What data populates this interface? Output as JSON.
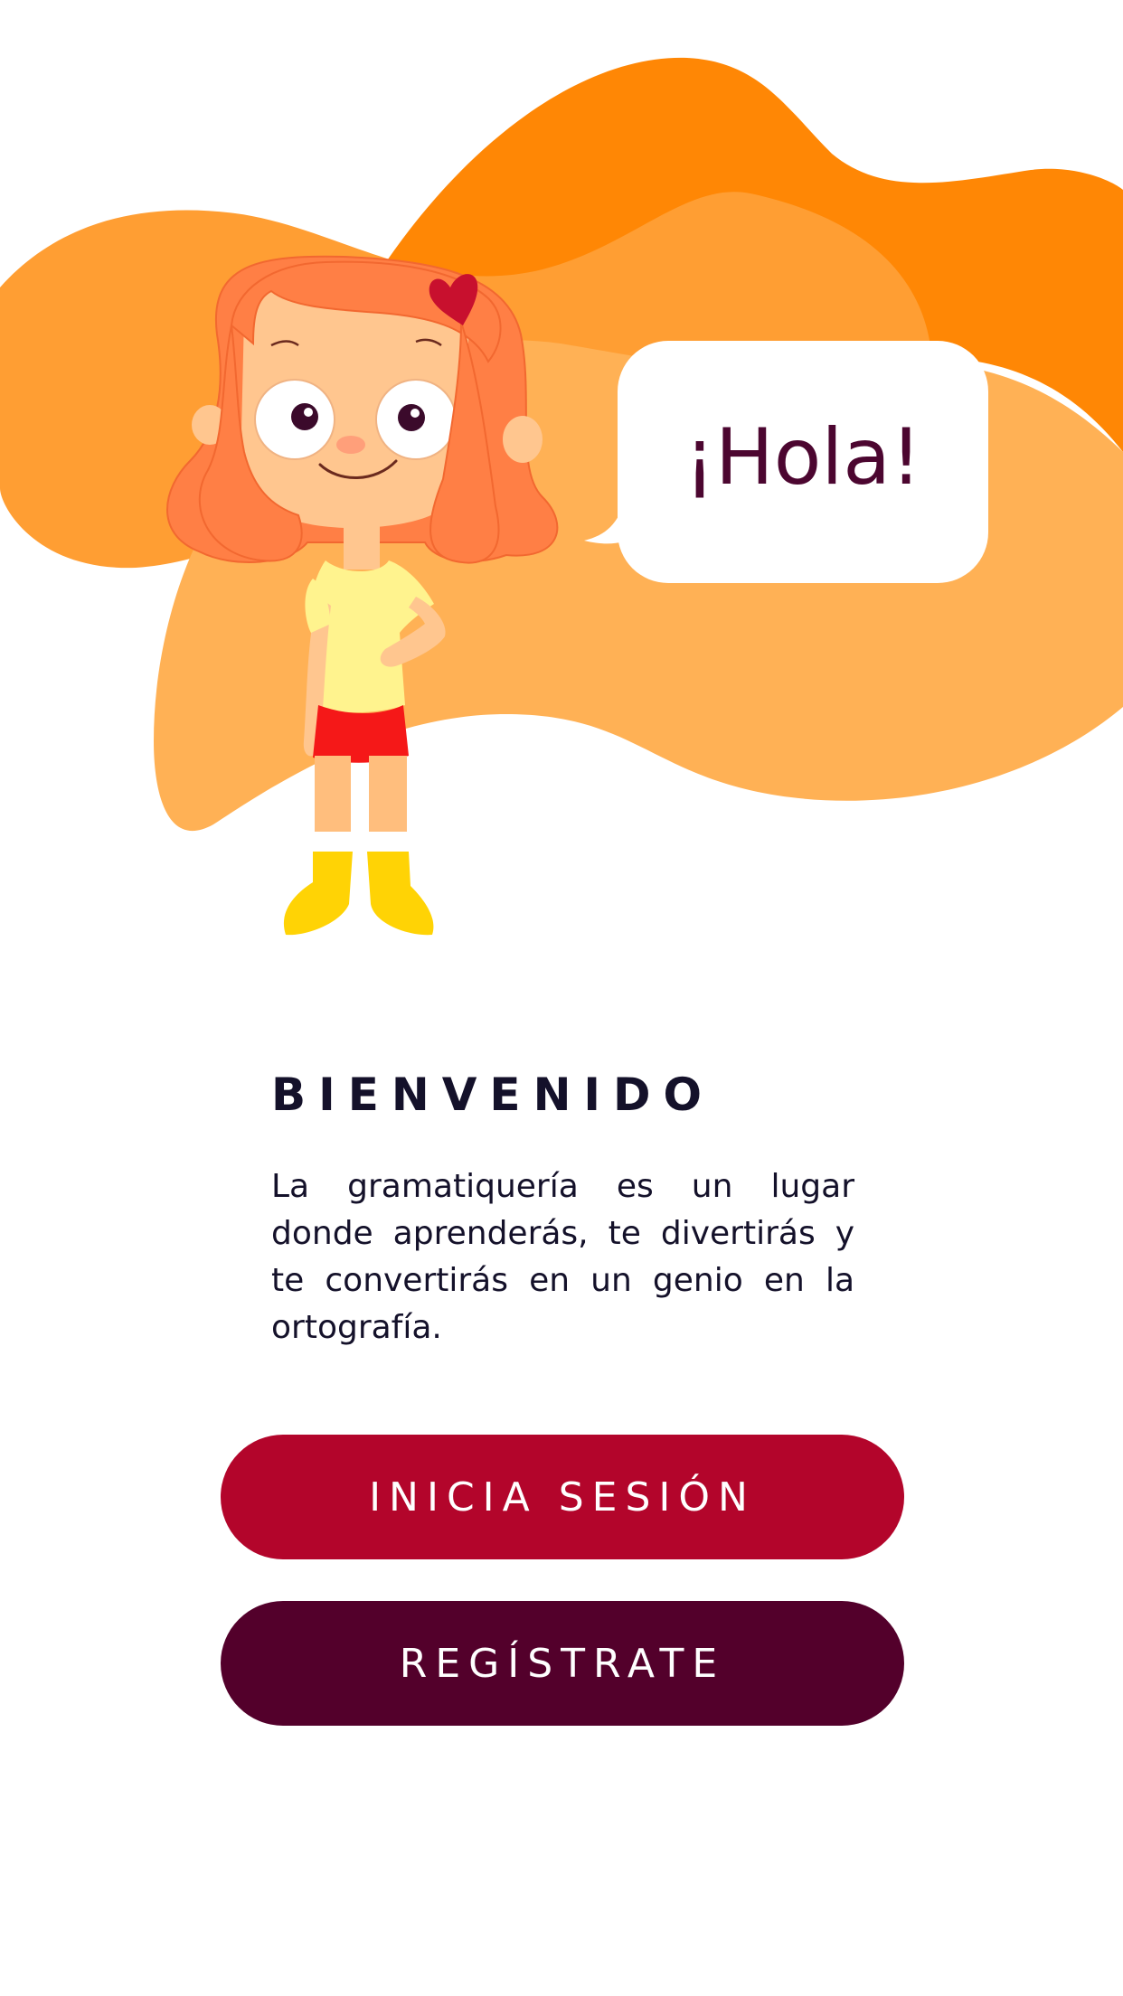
{
  "hero": {
    "greeting": "¡Hola!",
    "character": "girl-mascot-illustration"
  },
  "welcome": {
    "title": "BIENVENIDO",
    "text": "La gramatiquería es un lugar donde aprenderás, te divertirás y te convertirás en un genio en la ortografía."
  },
  "actions": {
    "login_label": "INICIA SESIÓN",
    "register_label": "REGÍSTRATE"
  },
  "colors": {
    "blob_dark": "#ff8705",
    "blob_mid": "#ff9e33",
    "blob_light": "#ffb155",
    "login_button": "#b3052b",
    "register_button": "#53002b",
    "greeting_text": "#4c0630",
    "title_text": "#14112a"
  }
}
